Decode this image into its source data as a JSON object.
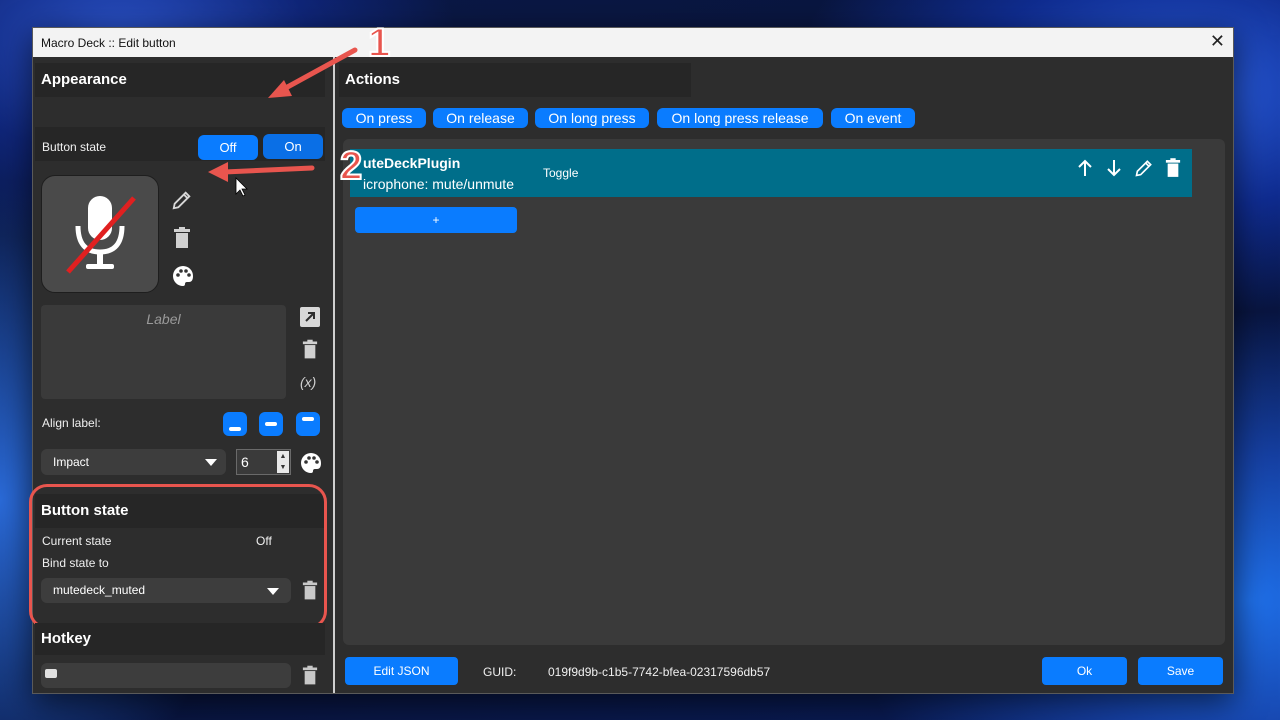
{
  "window": {
    "title": "Macro Deck :: Edit button",
    "close_glyph": "✕"
  },
  "appearance": {
    "heading": "Appearance",
    "button_state_label": "Button state",
    "off_label": "Off",
    "on_label": "On",
    "label_placeholder": "Label",
    "variable_glyph": "(x)",
    "align_label": "Align label:",
    "font": "Impact",
    "font_size": "6"
  },
  "button_state": {
    "heading": "Button state",
    "current_state_label": "Current state",
    "current_state_value": "Off",
    "bind_label": "Bind state to",
    "bind_value": "mutedeck_muted"
  },
  "hotkey": {
    "heading": "Hotkey",
    "value": ""
  },
  "actions": {
    "heading": "Actions",
    "tabs": [
      "On press",
      "On release",
      "On long press",
      "On long press release",
      "On event"
    ],
    "item": {
      "plugin": "uteDeckPlugin",
      "action": "icrophone: mute/unmute",
      "config": "Toggle"
    },
    "add_label": "+"
  },
  "footer": {
    "edit_json": "Edit JSON",
    "guid_label": "GUID:",
    "guid_value": "019f9d9b-c1b5-7742-bfea-02317596db57",
    "ok": "Ok",
    "save": "Save"
  },
  "annotations": {
    "one": "1",
    "two": "2"
  },
  "colors": {
    "accent": "#0a7cff",
    "action_row": "#006e8a",
    "annotation": "#e8554e"
  },
  "icons": [
    "close-icon",
    "mic-muted-icon",
    "pencil-icon",
    "trash-icon",
    "palette-icon",
    "expand-icon",
    "align-bottom-icon",
    "align-center-icon",
    "align-top-icon",
    "chevron-down-icon",
    "arrow-up-icon",
    "arrow-down-icon",
    "keyboard-icon",
    "mouse-cursor-icon"
  ]
}
